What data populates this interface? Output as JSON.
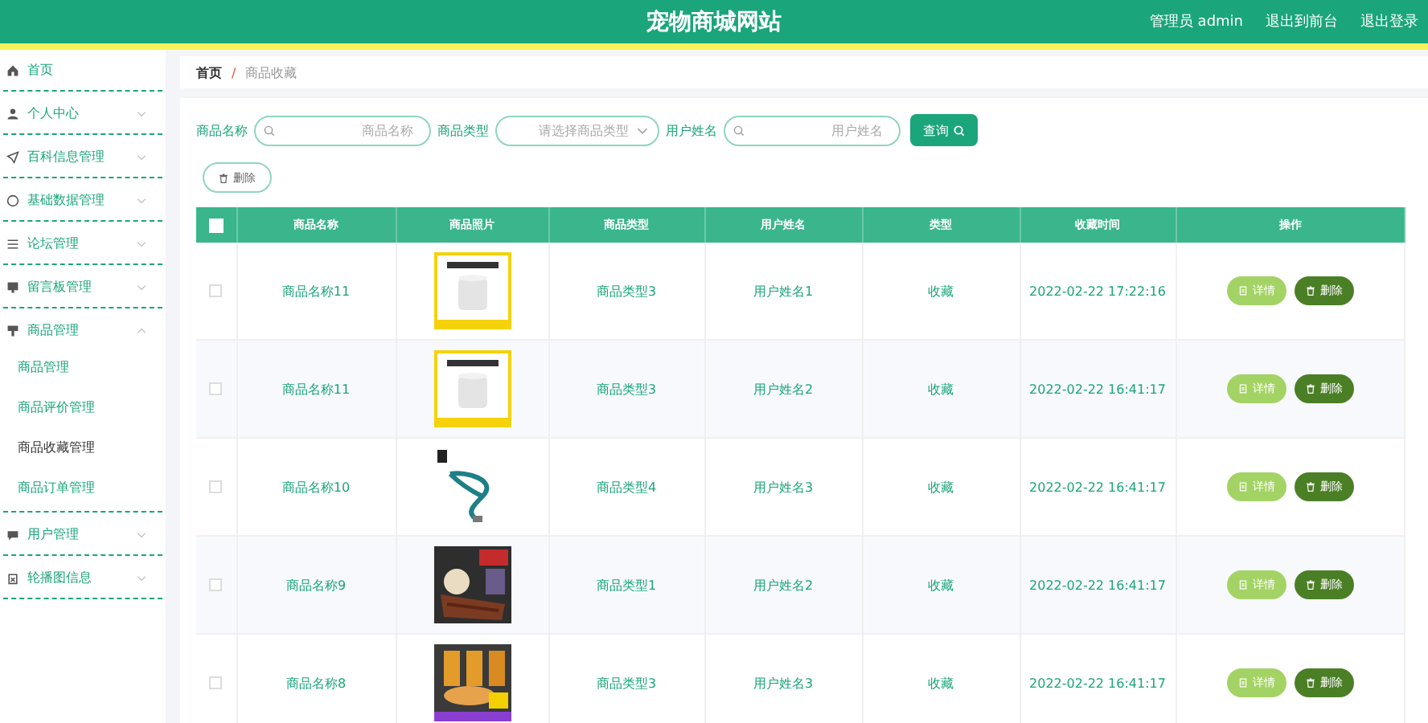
{
  "header": {
    "title": "宠物商城网站",
    "links": [
      "管理员 admin",
      "退出到前台",
      "退出登录"
    ]
  },
  "sidebar": {
    "items": [
      {
        "label": "首页"
      },
      {
        "label": "个人中心",
        "expanded": false
      },
      {
        "label": "百科信息管理",
        "expanded": false
      },
      {
        "label": "基础数据管理",
        "expanded": false
      },
      {
        "label": "论坛管理",
        "expanded": false
      },
      {
        "label": "留言板管理",
        "expanded": false
      },
      {
        "label": "商品管理",
        "expanded": true,
        "children": [
          {
            "label": "商品管理",
            "selected": false
          },
          {
            "label": "商品评价管理",
            "selected": false
          },
          {
            "label": "商品收藏管理",
            "selected": true
          },
          {
            "label": "商品订单管理",
            "selected": false
          }
        ]
      },
      {
        "label": "用户管理",
        "expanded": false
      },
      {
        "label": "轮播图信息",
        "expanded": false
      }
    ]
  },
  "breadcrumb": [
    "首页",
    "/",
    "商品收藏"
  ],
  "search": {
    "fields": [
      {
        "kind": "input",
        "label": "商品名称",
        "placeholder": "商品名称"
      },
      {
        "kind": "select",
        "label": "商品类型",
        "placeholder": "请选择商品类型"
      },
      {
        "kind": "input",
        "label": "用户姓名",
        "placeholder": "用户姓名"
      }
    ],
    "button": "查询"
  },
  "delete_button": "删除",
  "table": {
    "all_checked": false,
    "columns": [
      "商品名称",
      "商品照片",
      "商品类型",
      "用户姓名",
      "类型",
      "收藏时间",
      "操作"
    ],
    "rows": [
      {
        "checked": false,
        "name": "商品名称11",
        "type": "商品类型3",
        "user": "用户姓名1",
        "kind": "收藏",
        "time": "2022-02-22 17:22:16",
        "actions": [
          "详情",
          "删除"
        ]
      },
      {
        "checked": false,
        "name": "商品名称11",
        "type": "商品类型3",
        "user": "用户姓名2",
        "kind": "收藏",
        "time": "2022-02-22 16:41:17",
        "actions": [
          "详情",
          "删除"
        ]
      },
      {
        "checked": false,
        "name": "商品名称10",
        "type": "商品类型4",
        "user": "用户姓名3",
        "kind": "收藏",
        "time": "2022-02-22 16:41:17",
        "actions": [
          "详情",
          "删除"
        ]
      },
      {
        "checked": false,
        "name": "商品名称9",
        "type": "商品类型1",
        "user": "用户姓名2",
        "kind": "收藏",
        "time": "2022-02-22 16:41:17",
        "actions": [
          "详情",
          "删除"
        ]
      },
      {
        "checked": false,
        "name": "商品名称8",
        "type": "商品类型3",
        "user": "用户姓名3",
        "kind": "收藏",
        "time": "2022-02-22 16:41:17",
        "actions": [
          "详情",
          "删除"
        ]
      }
    ]
  }
}
